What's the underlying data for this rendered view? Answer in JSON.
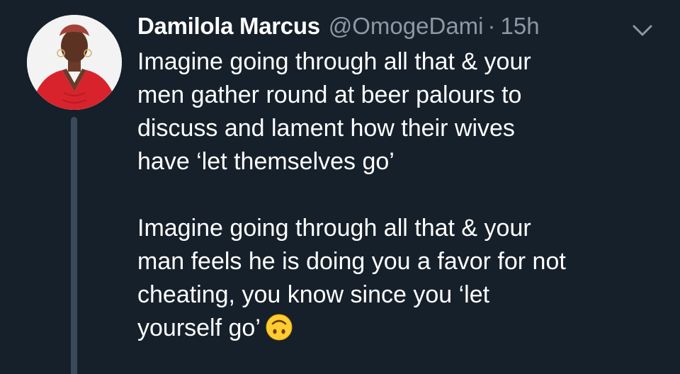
{
  "tweet": {
    "author": {
      "name": "Damilola Marcus",
      "handle": "@OmogeDami",
      "separator": "·",
      "time": "15h",
      "avatar_icon": "profile-photo"
    },
    "menu_icon": "chevron-down-icon",
    "paragraphs": [
      {
        "lines": [
          "Imagine going through all that & your",
          "men gather round at beer palours to",
          "discuss and lament how their wives",
          "have ‘let themselves go’"
        ]
      },
      {
        "lines": [
          "Imagine going through all that & your",
          "man feels he is doing you a favor for not",
          "cheating, you know since you ‘let",
          "yourself go’"
        ],
        "trailing_emoji": "upside-down-face-emoji"
      }
    ]
  },
  "colors": {
    "background": "#16202b",
    "text": "#ffffff",
    "muted": "#8b98a5",
    "thread_line": "#3a4a5a"
  }
}
